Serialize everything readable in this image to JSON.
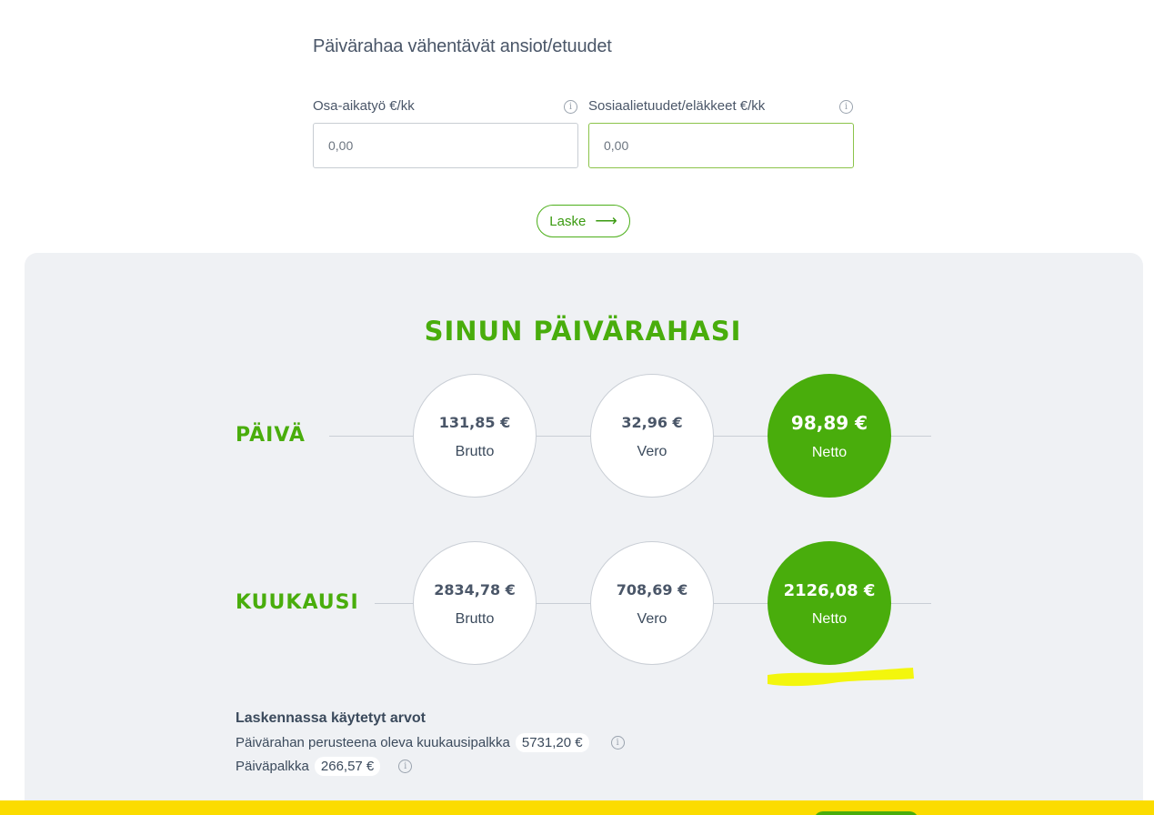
{
  "form": {
    "section_title": "Päivärahaa vähentävät ansiot/etuudet",
    "part_time": {
      "label": "Osa-aikatyö €/kk",
      "placeholder": "0,00"
    },
    "benefits": {
      "label": "Sosiaalietuudet/eläkkeet €/kk",
      "placeholder": "0,00"
    },
    "info_glyph": "i",
    "calculate_label": "Laske",
    "arrow": "⟶"
  },
  "results": {
    "title": "SINUN PÄIVÄRAHASI",
    "day": {
      "label": "PÄIVÄ",
      "gross": "131,85 €",
      "gross_caption": "Brutto",
      "tax": "32,96 €",
      "tax_caption": "Vero",
      "net": "98,89 €",
      "net_caption": "Netto"
    },
    "month": {
      "label": "KUUKAUSI",
      "gross": "2834,78 €",
      "gross_caption": "Brutto",
      "tax": "708,69 €",
      "tax_caption": "Vero",
      "net": "2126,08 €",
      "net_caption": "Netto"
    }
  },
  "used_values": {
    "title": "Laskennassa käytetyt arvot",
    "monthly_salary_label": "Päivärahan perusteena oleva kuukausipalkka",
    "monthly_salary_value": "5731,20 €",
    "daily_salary_label": "Päiväpalkka",
    "daily_salary_value": "266,57 €"
  },
  "colors": {
    "brand_green": "#49ad0c",
    "highlight_yellow": "#f2f500",
    "bar_yellow": "#fbdc00",
    "panel_bg": "#eff1f4"
  }
}
